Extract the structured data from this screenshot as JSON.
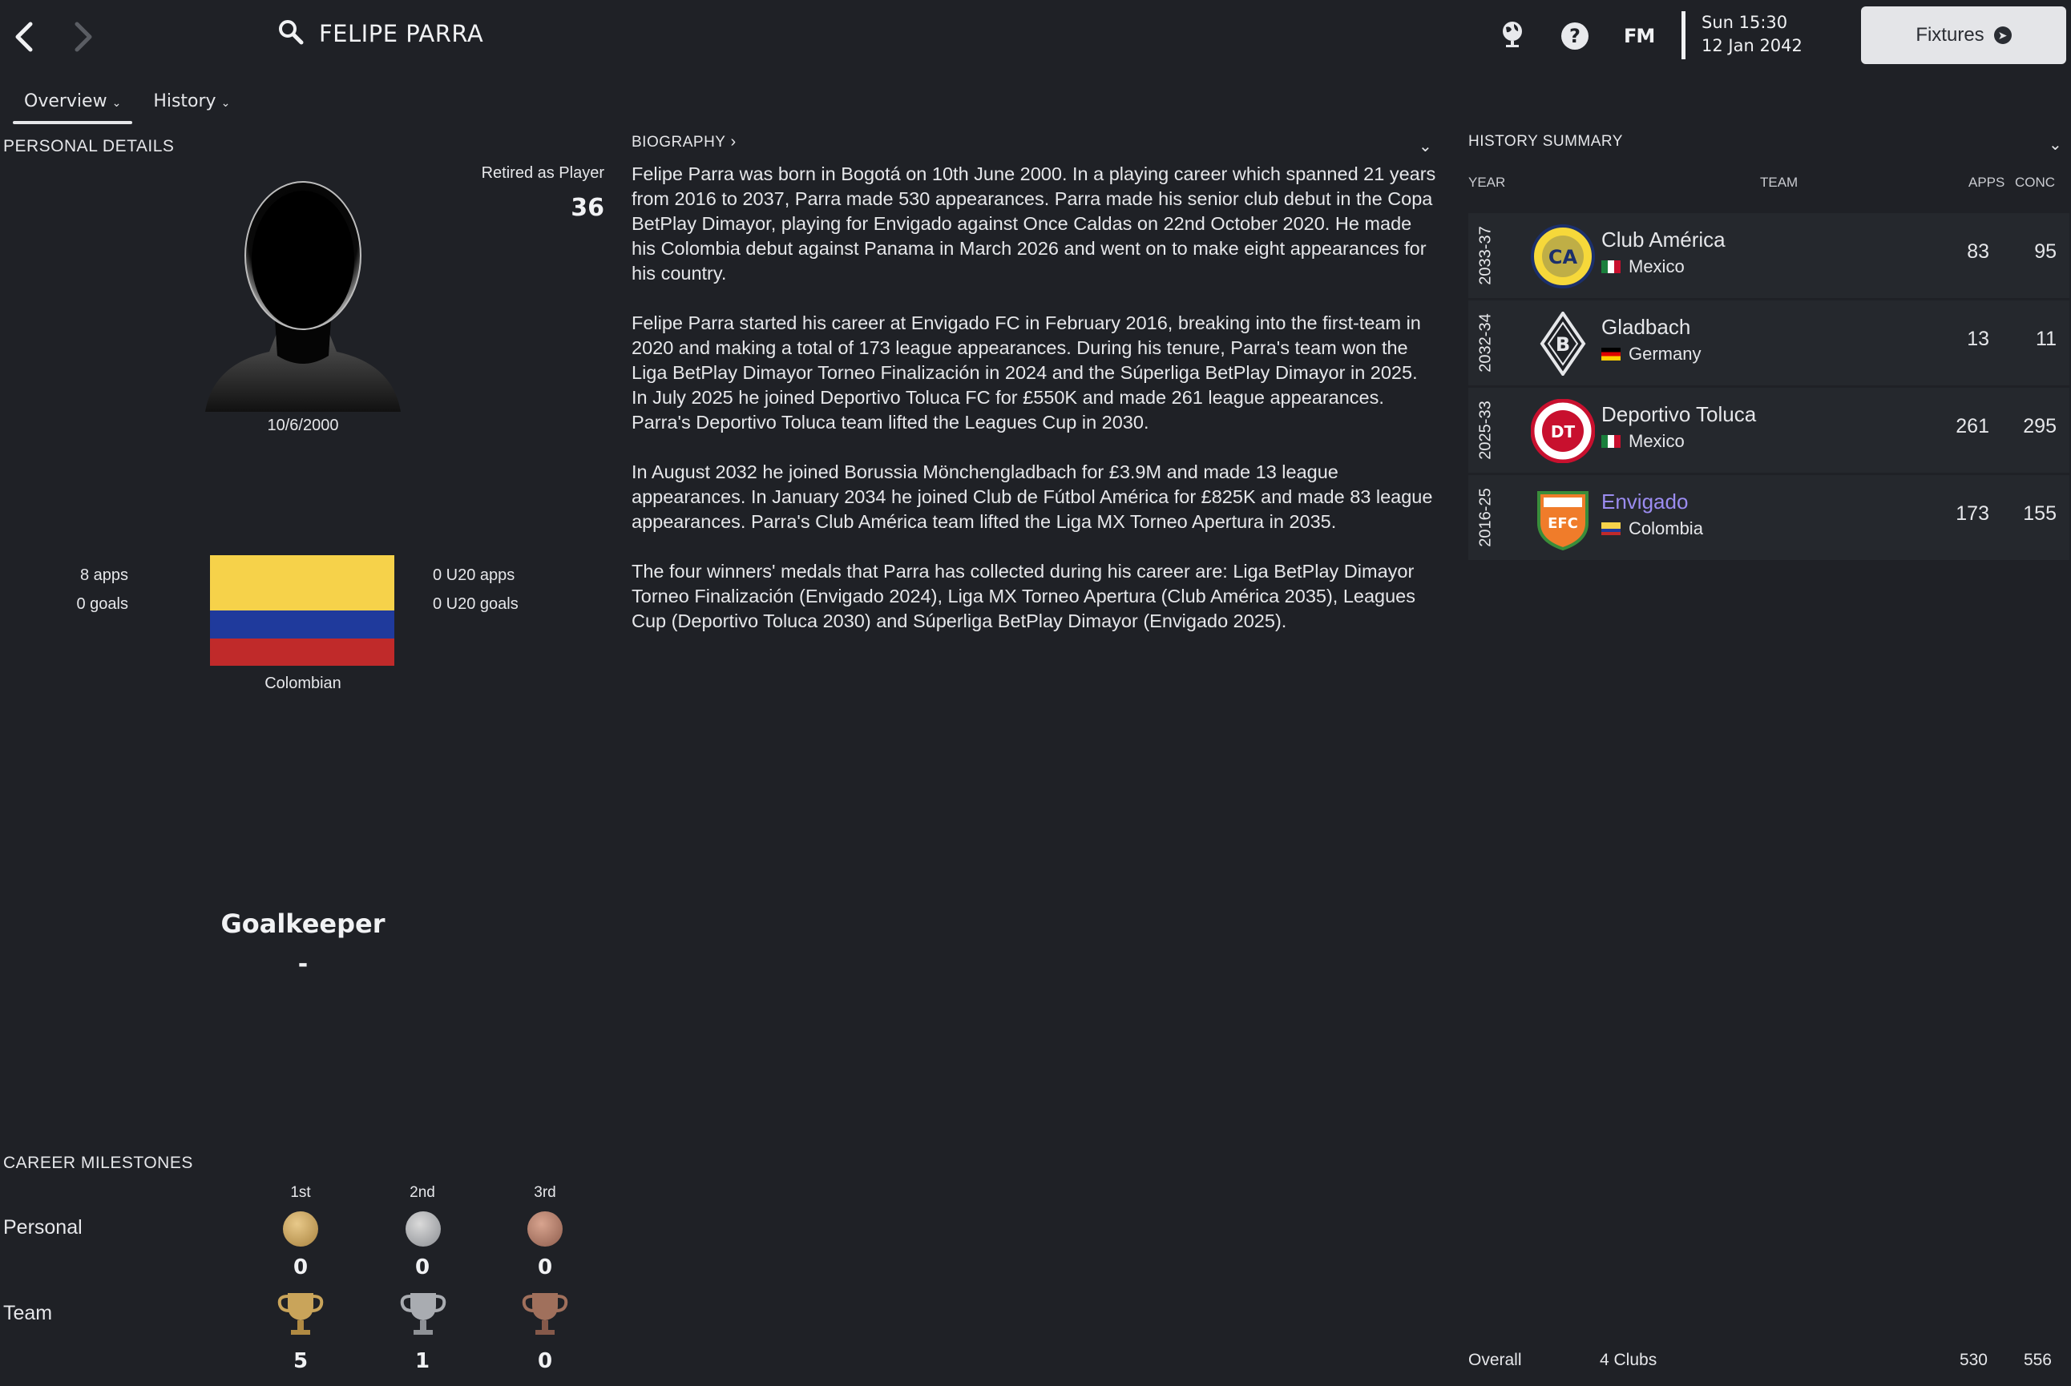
{
  "header": {
    "player_name": "FELIPE PARRA",
    "time": "Sun 15:30",
    "date": "12 Jan 2042",
    "fixtures_label": "Fixtures",
    "fm_label": "FM",
    "help_label": "?"
  },
  "tabs": [
    {
      "label": "Overview",
      "active": true
    },
    {
      "label": "History",
      "active": false
    }
  ],
  "personal": {
    "title": "PERSONAL DETAILS",
    "status_label": "Retired as Player",
    "age": "36",
    "dob": "10/6/2000",
    "intl_apps": "8 apps",
    "intl_goals": "0 goals",
    "u20_apps": "0 U20 apps",
    "u20_goals": "0 U20 goals",
    "nationality": "Colombian",
    "position": "Goalkeeper",
    "role": "-"
  },
  "biography": {
    "title": "BIOGRAPHY",
    "paragraphs": [
      "Felipe Parra was born in Bogotá on 10th June 2000. In a playing career which spanned 21 years from 2016 to 2037, Parra made 530 appearances. Parra made his senior club debut in the Copa BetPlay Dimayor, playing for Envigado against Once Caldas on 22nd October 2020. He made his Colombia debut against Panama in March 2026 and went on to make eight appearances for his country.",
      "Felipe Parra started his career at Envigado FC in February 2016, breaking into the first-team in 2020 and making a total of 173 league appearances. During his tenure, Parra's team won the Liga BetPlay Dimayor Torneo Finalización in 2024 and the Súperliga BetPlay Dimayor in 2025. In July 2025 he joined Deportivo Toluca FC for £550K and made 261 league appearances. Parra's Deportivo Toluca team lifted the Leagues Cup in 2030.",
      "In August 2032 he joined Borussia Mönchengladbach for £3.9M and made 13 league appearances. In January 2034 he joined Club de Fútbol América for £825K and made 83 league appearances. Parra's Club América team lifted the Liga MX Torneo Apertura in 2035.",
      "The four winners' medals that Parra has collected during his career are: Liga BetPlay Dimayor Torneo Finalización (Envigado 2024), Liga MX Torneo Apertura (Club América 2035), Leagues Cup (Deportivo Toluca 2030) and Súperliga BetPlay Dimayor (Envigado 2025)."
    ]
  },
  "history": {
    "title": "HISTORY SUMMARY",
    "col_year": "YEAR",
    "col_team": "TEAM",
    "col_apps": "APPS",
    "col_conc": "CONC",
    "rows": [
      {
        "year": "2033-37",
        "team": "Club América",
        "nation": "Mexico",
        "apps": "83",
        "conc": "95",
        "crest_text": "CA"
      },
      {
        "year": "2032-34",
        "team": "Gladbach",
        "nation": "Germany",
        "apps": "13",
        "conc": "11",
        "crest_text": "B"
      },
      {
        "year": "2025-33",
        "team": "Deportivo Toluca",
        "nation": "Mexico",
        "apps": "261",
        "conc": "295",
        "crest_text": "DT"
      },
      {
        "year": "2016-25",
        "team": "Envigado",
        "nation": "Colombia",
        "apps": "173",
        "conc": "155",
        "crest_text": "EFC"
      }
    ],
    "overall_label": "Overall",
    "overall_clubs": "4 Clubs",
    "overall_apps": "530",
    "overall_conc": "556"
  },
  "milestones": {
    "title": "CAREER MILESTONES",
    "places": [
      "1st",
      "2nd",
      "3rd"
    ],
    "personal_label": "Personal",
    "personal_values": [
      "0",
      "0",
      "0"
    ],
    "team_label": "Team",
    "team_values": [
      "5",
      "1",
      "0"
    ]
  },
  "colors": {
    "background": "#1f2126",
    "row_background": "#25282d",
    "link": "#9b8cf0",
    "colombia_yellow": "#f6d24a",
    "colombia_blue": "#1f3a9c",
    "colombia_red": "#c02a2a"
  }
}
